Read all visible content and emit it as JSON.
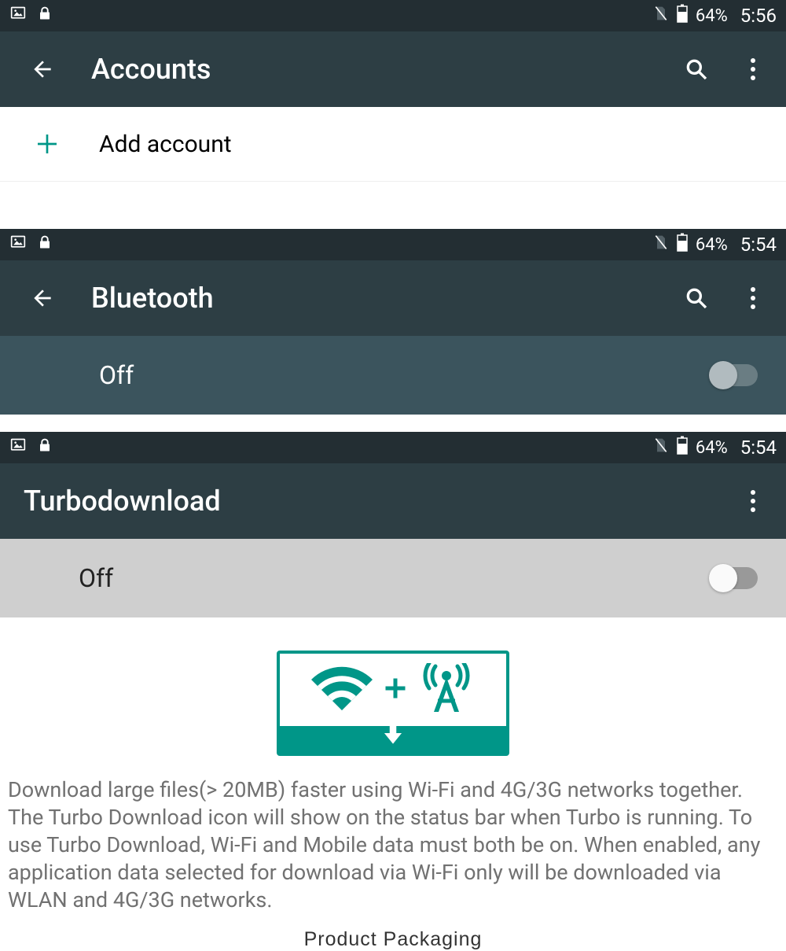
{
  "screens": {
    "accounts": {
      "status": {
        "battery": "64%",
        "time": "5:56"
      },
      "title": "Accounts",
      "add_label": "Add account"
    },
    "bluetooth": {
      "status": {
        "battery": "64%",
        "time": "5:54"
      },
      "title": "Bluetooth",
      "state": "Off"
    },
    "turbo": {
      "status": {
        "battery": "64%",
        "time": "5:54"
      },
      "title": "Turbodownload",
      "state": "Off",
      "description": "Download large files(> 20MB) faster using Wi-Fi and 4G/3G networks together. The Turbo Download icon will show on the status bar when Turbo is running. To use Turbo Download, Wi-Fi and Mobile data must both be on. When enabled, any application data selected for download via Wi-Fi only will be downloaded via WLAN and 4G/3G networks."
    }
  },
  "caption": "Product Packaging"
}
